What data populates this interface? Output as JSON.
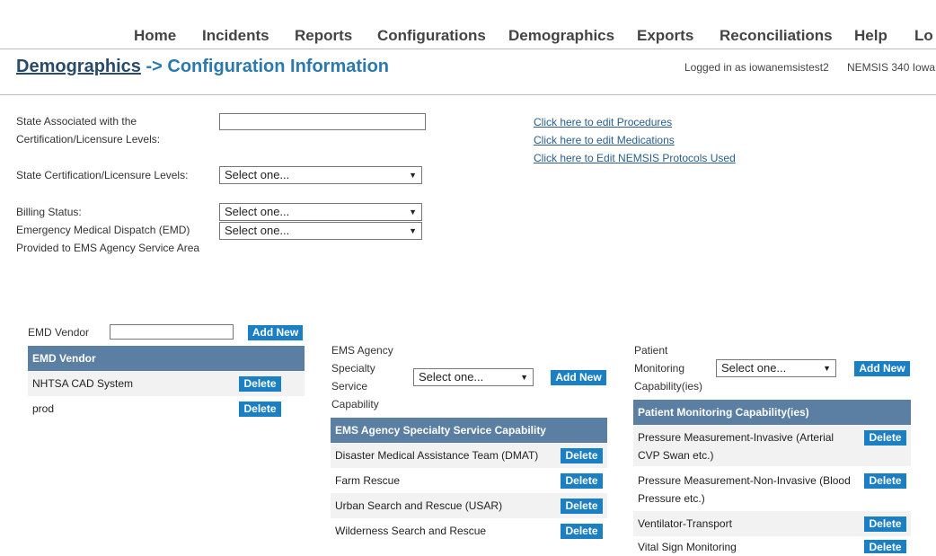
{
  "nav": [
    "Home",
    "Incidents",
    "Reports",
    "Configurations",
    "Demographics",
    "Exports",
    "Reconciliations",
    "Help",
    "Lo"
  ],
  "header": {
    "breadcrumb_link": "Demographics",
    "breadcrumb_rest": " -> Configuration Information",
    "logged_in": "Logged in as iowanemsistest2",
    "version": "NEMSIS 340 Iowa"
  },
  "form": {
    "state_assoc_label_1": "State Associated with the",
    "state_assoc_label_2": "Certification/Licensure Levels:",
    "state_assoc_value": "",
    "cert_levels_label": "State Certification/Licensure Levels:",
    "cert_levels_value": "Select one...",
    "billing_label": "Billing Status:",
    "billing_value": "Select one...",
    "emd_label_1": "Emergency Medical Dispatch (EMD)",
    "emd_label_2": "Provided to EMS Agency Service Area",
    "emd_value": "Select one..."
  },
  "links": {
    "procedures": "Click here to edit Procedures",
    "medications": "Click here to edit Medications",
    "protocols": "Click here to Edit NEMSIS Protocols Used"
  },
  "emd_vendor": {
    "label": "EMD Vendor",
    "input_value": "",
    "add_label": "Add New",
    "header": "EMD Vendor",
    "delete_label": "Delete",
    "rows": [
      "NHTSA CAD System",
      "prod"
    ]
  },
  "specialty": {
    "label_lines": [
      "EMS Agency",
      "Specialty",
      "Service",
      "Capability"
    ],
    "select_value": "Select one...",
    "add_label": "Add New",
    "header": "EMS Agency Specialty Service Capability",
    "delete_label": "Delete",
    "rows": [
      "Disaster Medical Assistance Team (DMAT)",
      "Farm Rescue",
      "Urban Search and Rescue (USAR)",
      "Wilderness Search and Rescue"
    ]
  },
  "monitoring": {
    "label_lines": [
      "Patient",
      "Monitoring",
      "Capability(ies)"
    ],
    "select_value": "Select one...",
    "add_label": "Add New",
    "header": "Patient Monitoring Capability(ies)",
    "delete_label": "Delete",
    "rows": [
      {
        "l1": "Pressure Measurement-Invasive (Arterial",
        "l2": "CVP Swan etc.)"
      },
      {
        "l1": "Pressure Measurement-Non-Invasive (Blood",
        "l2": "Pressure etc.)"
      },
      {
        "l1": "Ventilator-Transport",
        "l2": ""
      },
      {
        "l1": "Vital Sign Monitoring",
        "l2": ""
      }
    ]
  }
}
